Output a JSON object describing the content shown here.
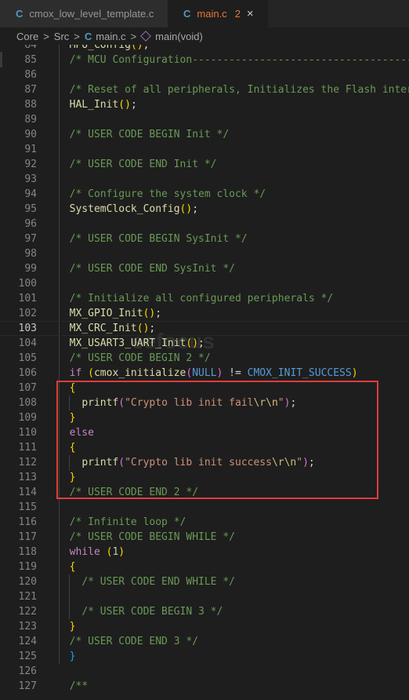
{
  "tabs": [
    {
      "icon": "C",
      "label": "cmox_low_level_template.c"
    },
    {
      "icon": "C",
      "label": "main.c",
      "problems": "2",
      "close": "×"
    }
  ],
  "breadcrumb": {
    "items": [
      "Core",
      "Src",
      "main.c",
      "main(void)"
    ],
    "separator": ">",
    "file_icon": "C"
  },
  "watermark": "eefocus",
  "editor": {
    "active_line": "103",
    "lines": [
      {
        "n": "84",
        "tokens": [
          [
            "fn",
            "MPU_Config"
          ],
          [
            "py",
            "()"
          ],
          [
            "df",
            ";"
          ]
        ]
      },
      {
        "n": "85",
        "tokens": [
          [
            "cm",
            "/* MCU Configuration--------------------------------------------------------*/"
          ]
        ]
      },
      {
        "n": "86",
        "tokens": []
      },
      {
        "n": "87",
        "tokens": [
          [
            "cm",
            "/* Reset of all peripherals, Initializes the Flash interface and the Systick. */"
          ]
        ]
      },
      {
        "n": "88",
        "tokens": [
          [
            "fn",
            "HAL_Init"
          ],
          [
            "py",
            "()"
          ],
          [
            "df",
            ";"
          ]
        ]
      },
      {
        "n": "89",
        "tokens": []
      },
      {
        "n": "90",
        "tokens": [
          [
            "cm",
            "/* USER CODE BEGIN Init */"
          ]
        ]
      },
      {
        "n": "91",
        "tokens": []
      },
      {
        "n": "92",
        "tokens": [
          [
            "cm",
            "/* USER CODE END Init */"
          ]
        ]
      },
      {
        "n": "93",
        "tokens": []
      },
      {
        "n": "94",
        "tokens": [
          [
            "cm",
            "/* Configure the system clock */"
          ]
        ]
      },
      {
        "n": "95",
        "tokens": [
          [
            "fn",
            "SystemClock_Config"
          ],
          [
            "py",
            "()"
          ],
          [
            "df",
            ";"
          ]
        ]
      },
      {
        "n": "96",
        "tokens": []
      },
      {
        "n": "97",
        "tokens": [
          [
            "cm",
            "/* USER CODE BEGIN SysInit */"
          ]
        ]
      },
      {
        "n": "98",
        "tokens": []
      },
      {
        "n": "99",
        "tokens": [
          [
            "cm",
            "/* USER CODE END SysInit */"
          ]
        ]
      },
      {
        "n": "100",
        "tokens": []
      },
      {
        "n": "101",
        "tokens": [
          [
            "cm",
            "/* Initialize all configured peripherals */"
          ]
        ]
      },
      {
        "n": "102",
        "tokens": [
          [
            "fn",
            "MX_GPIO_Init"
          ],
          [
            "py",
            "()"
          ],
          [
            "df",
            ";"
          ]
        ]
      },
      {
        "n": "103",
        "tokens": [
          [
            "fn",
            "MX_CRC_Init"
          ],
          [
            "py",
            "()"
          ],
          [
            "df",
            ";"
          ]
        ]
      },
      {
        "n": "104",
        "tokens": [
          [
            "fn",
            "MX_USART3_UART_Init"
          ],
          [
            "py",
            "()"
          ],
          [
            "df",
            ";"
          ]
        ]
      },
      {
        "n": "105",
        "tokens": [
          [
            "cm",
            "/* USER CODE BEGIN 2 */"
          ]
        ]
      },
      {
        "n": "106",
        "tokens": [
          [
            "kw",
            "if"
          ],
          [
            "df",
            " "
          ],
          [
            "py",
            "("
          ],
          [
            "fn",
            "cmox_initialize"
          ],
          [
            "pb",
            "("
          ],
          [
            "mc",
            "NULL"
          ],
          [
            "pb",
            ")"
          ],
          [
            "df",
            " != "
          ],
          [
            "mc",
            "CMOX_INIT_SUCCESS"
          ],
          [
            "py",
            ")"
          ]
        ]
      },
      {
        "n": "107",
        "tokens": [
          [
            "py",
            "{"
          ]
        ]
      },
      {
        "n": "108",
        "tokens": [
          [
            "df",
            "  "
          ],
          [
            "fn",
            "printf"
          ],
          [
            "pb",
            "("
          ],
          [
            "st",
            "\"Crypto lib init fail"
          ],
          [
            "es",
            "\\r\\n"
          ],
          [
            "st",
            "\""
          ],
          [
            "pb",
            ")"
          ],
          [
            "df",
            ";"
          ]
        ]
      },
      {
        "n": "109",
        "tokens": [
          [
            "py",
            "}"
          ]
        ]
      },
      {
        "n": "110",
        "tokens": [
          [
            "kw",
            "else"
          ]
        ]
      },
      {
        "n": "111",
        "tokens": [
          [
            "py",
            "{"
          ]
        ]
      },
      {
        "n": "112",
        "tokens": [
          [
            "df",
            "  "
          ],
          [
            "fn",
            "printf"
          ],
          [
            "pb",
            "("
          ],
          [
            "st",
            "\"Crypto lib init success"
          ],
          [
            "es",
            "\\r\\n"
          ],
          [
            "st",
            "\""
          ],
          [
            "pb",
            ")"
          ],
          [
            "df",
            ";"
          ]
        ]
      },
      {
        "n": "113",
        "tokens": [
          [
            "py",
            "}"
          ]
        ]
      },
      {
        "n": "114",
        "tokens": [
          [
            "cm",
            "/* USER CODE END 2 */"
          ]
        ]
      },
      {
        "n": "115",
        "tokens": []
      },
      {
        "n": "116",
        "tokens": [
          [
            "cm",
            "/* Infinite loop */"
          ]
        ]
      },
      {
        "n": "117",
        "tokens": [
          [
            "cm",
            "/* USER CODE BEGIN WHILE */"
          ]
        ]
      },
      {
        "n": "118",
        "tokens": [
          [
            "kw",
            "while"
          ],
          [
            "df",
            " "
          ],
          [
            "py",
            "("
          ],
          [
            "nu",
            "1"
          ],
          [
            "py",
            ")"
          ]
        ]
      },
      {
        "n": "119",
        "tokens": [
          [
            "py",
            "{"
          ]
        ]
      },
      {
        "n": "120",
        "tokens": [
          [
            "df",
            "  "
          ],
          [
            "cm",
            "/* USER CODE END WHILE */"
          ]
        ]
      },
      {
        "n": "121",
        "tokens": []
      },
      {
        "n": "122",
        "tokens": [
          [
            "df",
            "  "
          ],
          [
            "cm",
            "/* USER CODE BEGIN 3 */"
          ]
        ]
      },
      {
        "n": "123",
        "tokens": [
          [
            "py",
            "}"
          ]
        ]
      },
      {
        "n": "124",
        "tokens": [
          [
            "cm",
            "/* USER CODE END 3 */"
          ]
        ]
      },
      {
        "n": "125",
        "tokens": [
          [
            "pl",
            "}"
          ]
        ]
      },
      {
        "n": "126",
        "tokens": []
      },
      {
        "n": "127",
        "tokens": [
          [
            "cm",
            "/**"
          ]
        ]
      }
    ]
  }
}
